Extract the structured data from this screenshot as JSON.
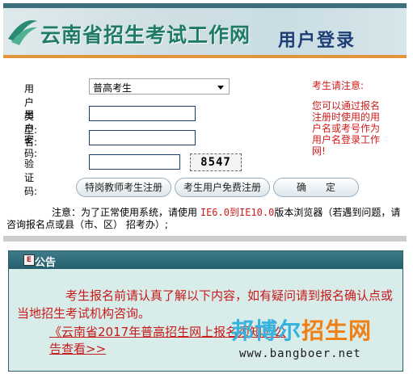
{
  "header": {
    "site_title": "云南省招生考试工作网",
    "page_title": "用户登录"
  },
  "form": {
    "user_type_label": "用户类型:",
    "user_type_selected": "普高考生",
    "username_label": "用户名:",
    "username_value": "",
    "password_label": "密　　码:",
    "password_value": "",
    "captcha_label": "验证码:",
    "captcha_value": "",
    "captcha_image_text": "8547",
    "buttons": {
      "teacher_register": "特岗教师考生注册",
      "free_register": "考生用户免费注册",
      "confirm": "确　　定"
    }
  },
  "notice": {
    "title": "考生请注意:",
    "body": "您可以通过报名注册时使用的用户名或考号作为用户名登录工作网!"
  },
  "tip": {
    "prefix": "注意：为了正常使用系统，请使用",
    "browsers": "IE6.0到IE10.0",
    "suffix": "版本浏览器（若遇到问题，请咨询报名点或县（市、区） 招考办）;"
  },
  "announcement": {
    "header": "公告",
    "text": "考生报名前请认真了解以下内容，如有疑问请到报名确认点或当地招生考试机构咨询。",
    "link": "《云南省2017年普高招生网上报名须知》公告查看>>"
  },
  "watermark": {
    "brand_part1": "邦博尔",
    "brand_part2": "招生网",
    "url": "www.bangboer.net"
  },
  "colors": {
    "header_green": "#1f7b68",
    "notice_red": "#d01b1b",
    "panel_header": "#2f6f7e",
    "panel_bg": "#d8ece9"
  }
}
